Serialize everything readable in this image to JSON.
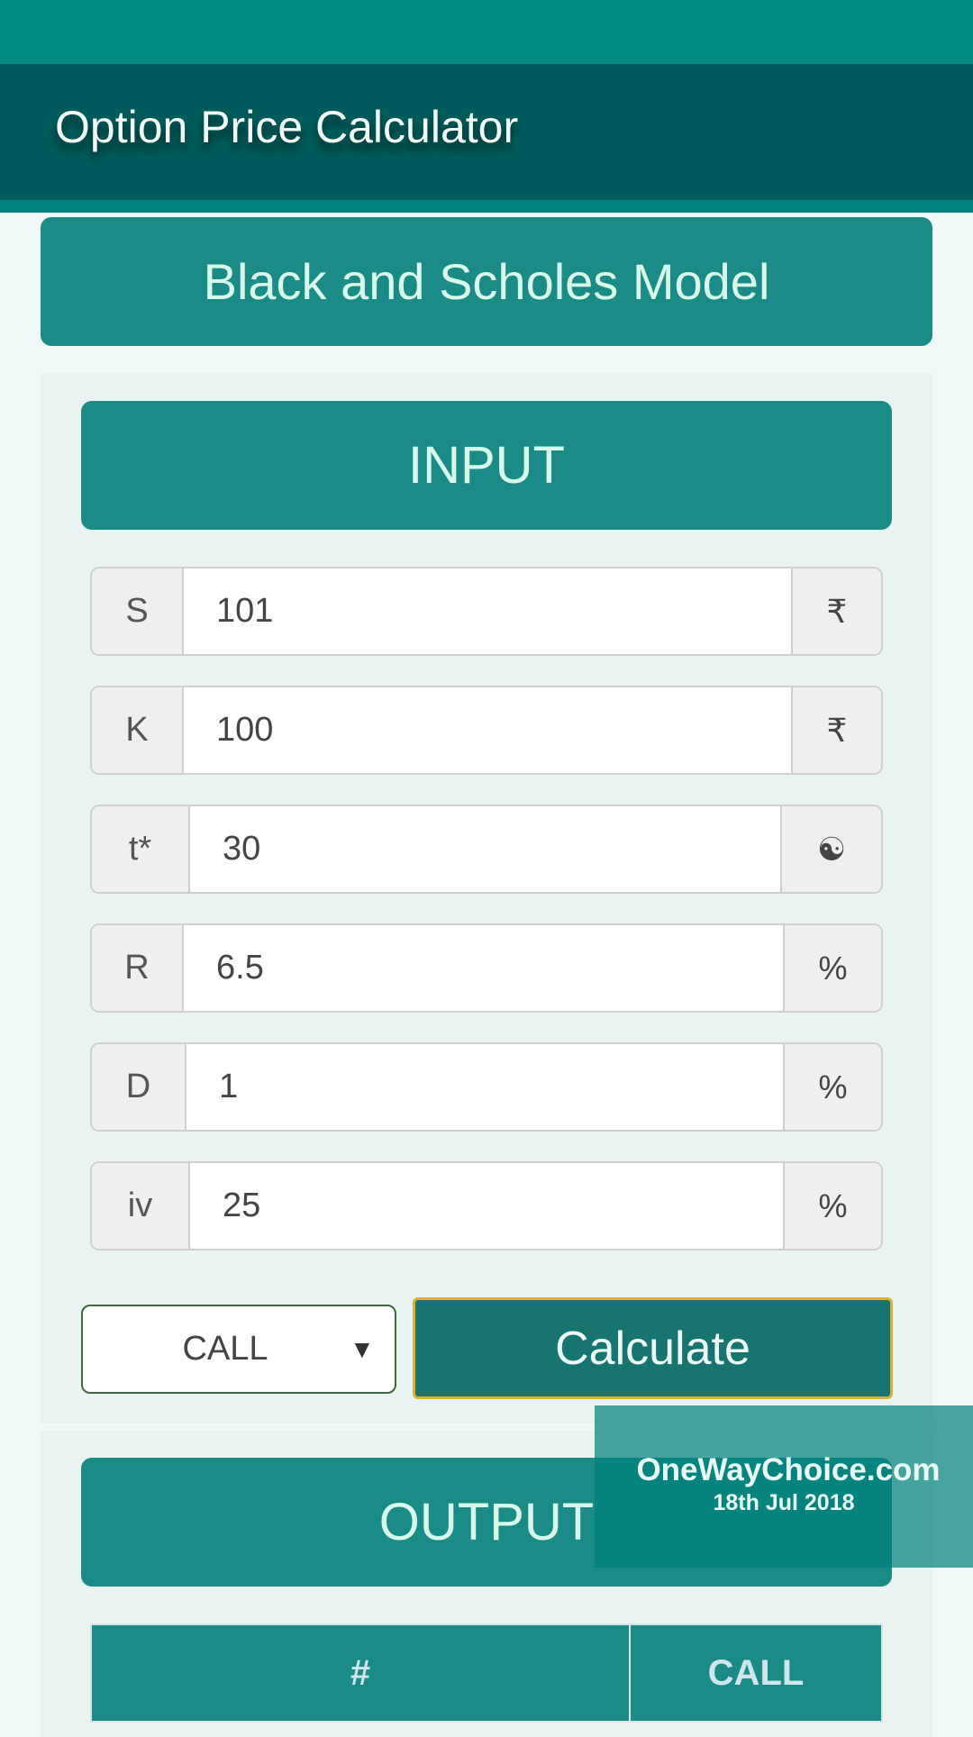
{
  "app": {
    "title": "Option Price Calculator"
  },
  "model": {
    "title": "Black and Scholes Model"
  },
  "input": {
    "heading": "INPUT",
    "fields": [
      {
        "label": "S",
        "value": "101",
        "addon": "₹",
        "icon": "rupee-icon"
      },
      {
        "label": "K",
        "value": "100",
        "addon": "₹",
        "icon": "rupee-icon"
      },
      {
        "label": "t*",
        "value": "30",
        "addon": "☯",
        "icon": "yin-yang-icon"
      },
      {
        "label": "R",
        "value": "6.5",
        "addon": "%",
        "icon": "percent-icon"
      },
      {
        "label": "D",
        "value": "1",
        "addon": "%",
        "icon": "percent-icon"
      },
      {
        "label": "iv",
        "value": "25",
        "addon": "%",
        "icon": "percent-icon"
      }
    ],
    "option_type": "CALL",
    "dropdown_arrow": "▼",
    "calculate_label": "Calculate"
  },
  "output": {
    "heading": "OUTPUT",
    "columns": [
      "#",
      "CALL"
    ]
  },
  "watermark": {
    "site": "OneWayChoice.com",
    "date": "18th Jul 2018"
  },
  "colors": {
    "primary": "#1a8b87",
    "appbar": "#005c5c",
    "accent_border": "#e0b030"
  }
}
